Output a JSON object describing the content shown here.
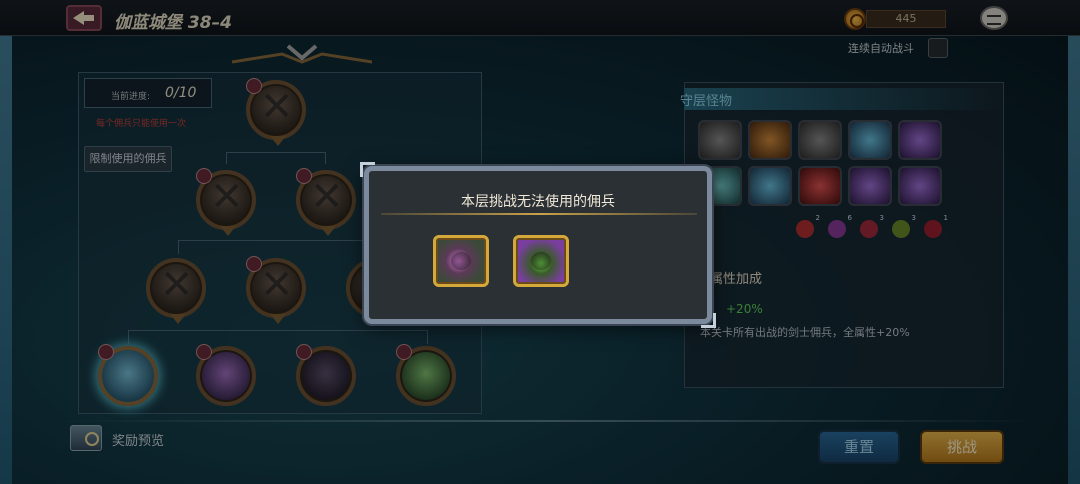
{
  "top_bar": {
    "stage_title": "伽蓝城堡 38–4",
    "currency_value": "445",
    "auto_battle_label": "连续自动战斗"
  },
  "tower": {
    "progress_label": "当前进度:",
    "progress_value": "0/10",
    "warning_text": "每个佣兵只能使用一次",
    "restrict_button_label": "限制使用的佣兵"
  },
  "floor_monsters": {
    "header": "守层怪物",
    "element_counts": [
      "2",
      "6",
      "3",
      "3",
      "1"
    ]
  },
  "attribute_bonus": {
    "title": "属性加成",
    "value": "+20%",
    "description": "本关卡所有出战的剑士佣兵，全属性+20%"
  },
  "bottom": {
    "reward_preview_label": "奖励预览",
    "reset_button_label": "重置",
    "challenge_button_label": "挑战"
  },
  "modal": {
    "title": "本层挑战无法使用的佣兵",
    "mercenaries": [
      "merc-witch-icon",
      "merc-catbeast-icon"
    ]
  },
  "colors": {
    "accent_gold": "#c9a24a",
    "bonus_green": "#5ccf56",
    "warning_red": "#c0403a"
  }
}
